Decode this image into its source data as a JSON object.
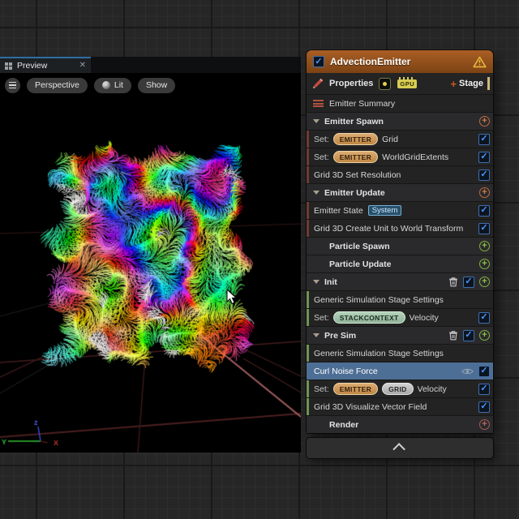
{
  "preview": {
    "tab_label": "Preview",
    "toolbar": {
      "perspective": "Perspective",
      "lit": "Lit",
      "show": "Show"
    },
    "axis_labels": {
      "x": "X",
      "y": "Y",
      "z": "z"
    }
  },
  "emitter": {
    "title": "AdvectionEmitter",
    "enabled": true,
    "properties_label": "Properties",
    "gpu_badge": "GPU",
    "add_stage_label": "Stage",
    "rows": [
      {
        "kind": "summary",
        "label": "Emitter Summary"
      },
      {
        "kind": "group",
        "label": "Emitter Spawn",
        "arrow": true,
        "controls": [
          "plus-orange"
        ]
      },
      {
        "kind": "module",
        "prefix": "Set:",
        "badges": [
          "EMITTER"
        ],
        "label": "Grid",
        "accent": "red",
        "check": true
      },
      {
        "kind": "module",
        "prefix": "Set:",
        "badges": [
          "EMITTER"
        ],
        "label": "WorldGridExtents",
        "accent": "red",
        "check": true
      },
      {
        "kind": "module",
        "label": "Grid 3D Set Resolution",
        "accent": "red",
        "check": true
      },
      {
        "kind": "group",
        "label": "Emitter Update",
        "arrow": true,
        "controls": [
          "plus-orange"
        ]
      },
      {
        "kind": "module",
        "label": "Emitter State",
        "chip": "System",
        "accent": "red",
        "check": true
      },
      {
        "kind": "module",
        "label": "Grid 3D Create Unit to World Transform",
        "accent": "red",
        "check": true
      },
      {
        "kind": "group",
        "label": "Particle Spawn",
        "arrow": false,
        "controls": [
          "plus-green"
        ]
      },
      {
        "kind": "group",
        "label": "Particle Update",
        "arrow": false,
        "controls": [
          "plus-green"
        ]
      },
      {
        "kind": "group",
        "label": "Init",
        "arrow": true,
        "controls": [
          "trash",
          "check",
          "plus-green"
        ]
      },
      {
        "kind": "module",
        "label": "Generic Simulation Stage Settings",
        "accent": "green"
      },
      {
        "kind": "module",
        "prefix": "Set:",
        "badges": [
          "STACKCONTEXT"
        ],
        "label": "Velocity",
        "accent": "green",
        "check": true
      },
      {
        "kind": "group",
        "label": "Pre Sim",
        "arrow": true,
        "controls": [
          "trash",
          "check",
          "plus-green"
        ]
      },
      {
        "kind": "module",
        "label": "Generic Simulation Stage Settings",
        "accent": "green"
      },
      {
        "kind": "module",
        "label": "Curl Noise Force",
        "selected": true,
        "eye": true,
        "check": true
      },
      {
        "kind": "module",
        "prefix": "Set:",
        "badges": [
          "EMITTER",
          "GRID"
        ],
        "label": "Velocity",
        "accent": "green",
        "check": true
      },
      {
        "kind": "module",
        "label": "Grid 3D Visualize Vector Field",
        "accent": "green",
        "check": true
      },
      {
        "kind": "group",
        "label": "Render",
        "arrow": false,
        "controls": [
          "plus-red"
        ]
      }
    ],
    "colors": {
      "selection": "#4e6f95",
      "header_top": "#aa5f24",
      "header_bottom": "#7c4314",
      "check_blue": "#4896ff",
      "accent_red": "#6e3b33",
      "accent_green": "#6f9355"
    }
  },
  "icons": {
    "close": "✕",
    "check": "✓",
    "plus": "+"
  }
}
